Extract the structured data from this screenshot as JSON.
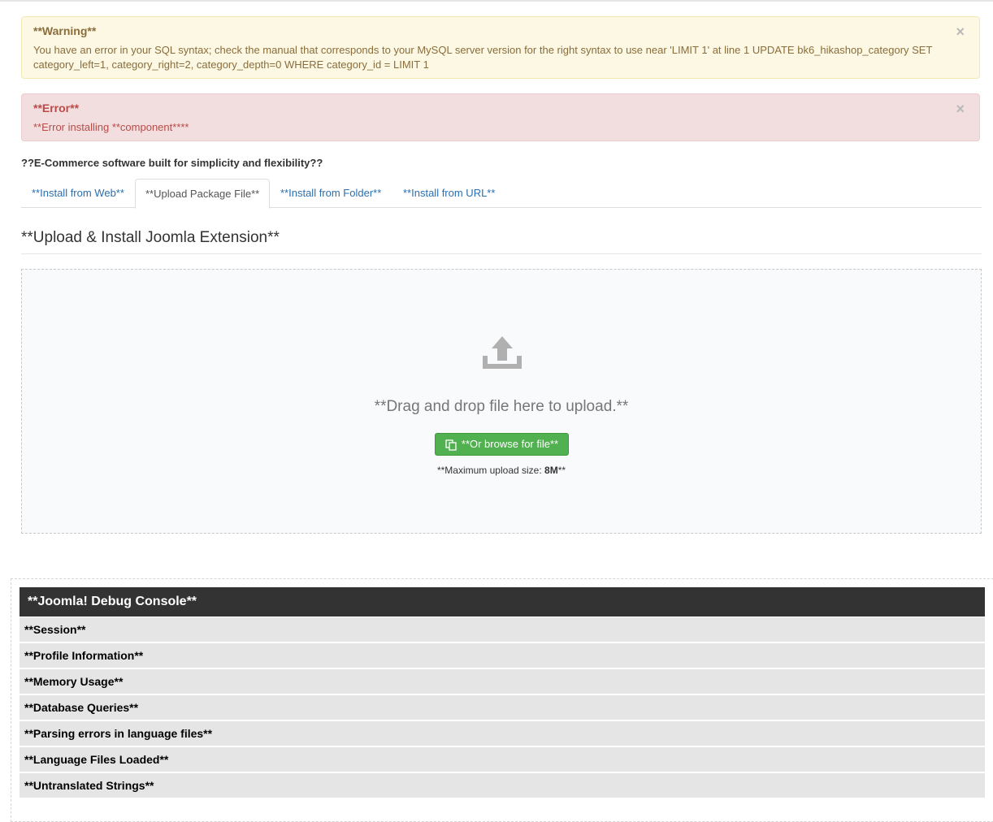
{
  "alerts": {
    "warning": {
      "heading": "**Warning**",
      "message": "You have an error in your SQL syntax; check the manual that corresponds to your MySQL server version for the right syntax to use near 'LIMIT 1' at line 1 UPDATE bk6_hikashop_category SET category_left=1, category_right=2, category_depth=0 WHERE category_id = LIMIT 1",
      "close": "×"
    },
    "error": {
      "heading": "**Error**",
      "message": "**Error installing **component****",
      "close": "×"
    }
  },
  "tagline": "??E-Commerce software built for simplicity and flexibility??",
  "tabs": [
    {
      "label": "**Install from Web**"
    },
    {
      "label": "**Upload Package File**"
    },
    {
      "label": "**Install from Folder**"
    },
    {
      "label": "**Install from URL**"
    }
  ],
  "upload": {
    "title": "**Upload & Install Joomla Extension**",
    "drop_text": "**Drag and drop file here to upload.**",
    "browse_button": "**Or browse for file**",
    "max_prefix": "**Maximum upload size: ",
    "max_value": "8M",
    "max_suffix": "**"
  },
  "debug": {
    "title": "**Joomla! Debug Console**",
    "items": [
      {
        "label": "**Session**"
      },
      {
        "label": "**Profile Information**"
      },
      {
        "label": "**Memory Usage**"
      },
      {
        "label": "**Database Queries**"
      },
      {
        "label": "**Parsing errors in language files**"
      },
      {
        "label": "**Language Files Loaded**"
      },
      {
        "label": "**Untranslated Strings**"
      }
    ]
  },
  "colors": {
    "warning_bg": "#fcf8e3",
    "error_bg": "#f2dede",
    "link": "#2a6fb0",
    "browse_green": "#51b04f",
    "debug_header": "#333333"
  },
  "icons": {
    "upload": "upload-icon",
    "browse": "copy-icon",
    "close": "close-icon"
  }
}
